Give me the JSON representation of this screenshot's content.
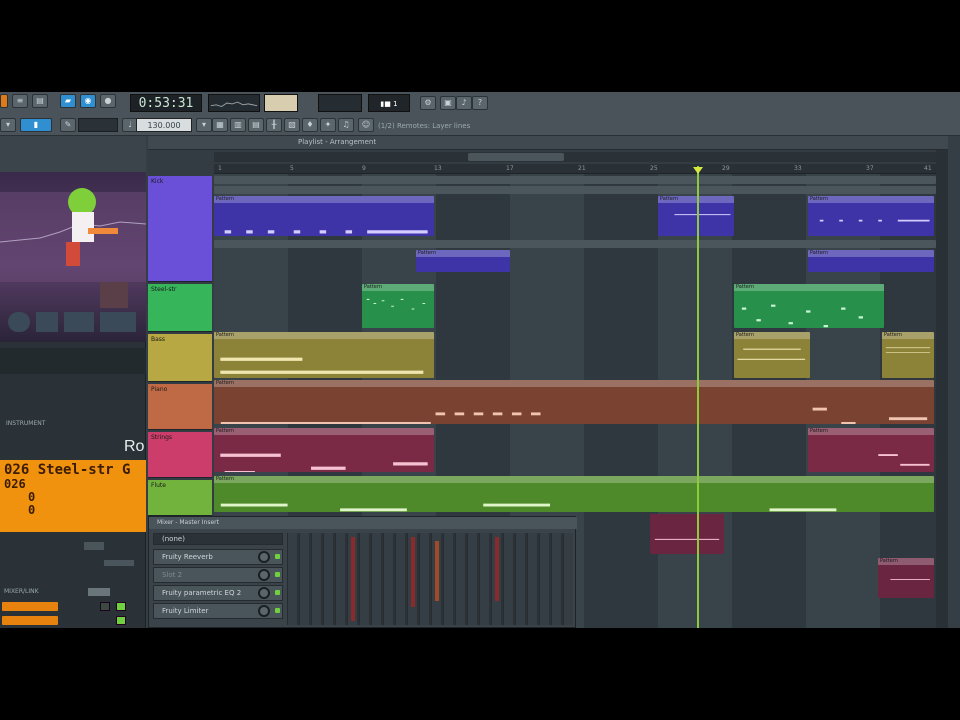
{
  "toolbar": {
    "time_display": "0:53:31",
    "tempo": "130.000",
    "pattern_label": "▮■ 1",
    "status_text": "(1/2) Remotes: Layer lines"
  },
  "left_panel": {
    "instrument_label": "INSTRUMENT",
    "brand": "Ro",
    "lcd": {
      "line1": "026 Steel-str G",
      "line2": "026",
      "line3": "0",
      "line4": "0"
    },
    "mixer_label": "MIXER/LINK"
  },
  "playlist": {
    "title": "Playlist - Arrangement",
    "ruler": [
      "1",
      "5",
      "9",
      "13",
      "17",
      "21",
      "25",
      "29",
      "33",
      "37",
      "41"
    ],
    "tracks": [
      {
        "name": "Kick",
        "color": "#6a4fd8"
      },
      {
        "name": "Steel-str",
        "color": "#36b55a"
      },
      {
        "name": "Bass",
        "color": "#b8a843"
      },
      {
        "name": "Piano",
        "color": "#c06a45"
      },
      {
        "name": "Strings",
        "color": "#cc3d6b"
      },
      {
        "name": "Flute",
        "color": "#71b33c"
      }
    ],
    "clip_label": "Pattern"
  },
  "mixer": {
    "title": "Mixer - Master Insert",
    "search_label": "(none)",
    "slots": [
      "Fruity Reeverb",
      "Slot 2",
      "Fruity parametric EQ 2",
      "Fruity Limiter"
    ]
  },
  "colors": {
    "accent": "#2f8fd0",
    "playhead": "#8ecb3a",
    "lcd": "#f1920f"
  }
}
